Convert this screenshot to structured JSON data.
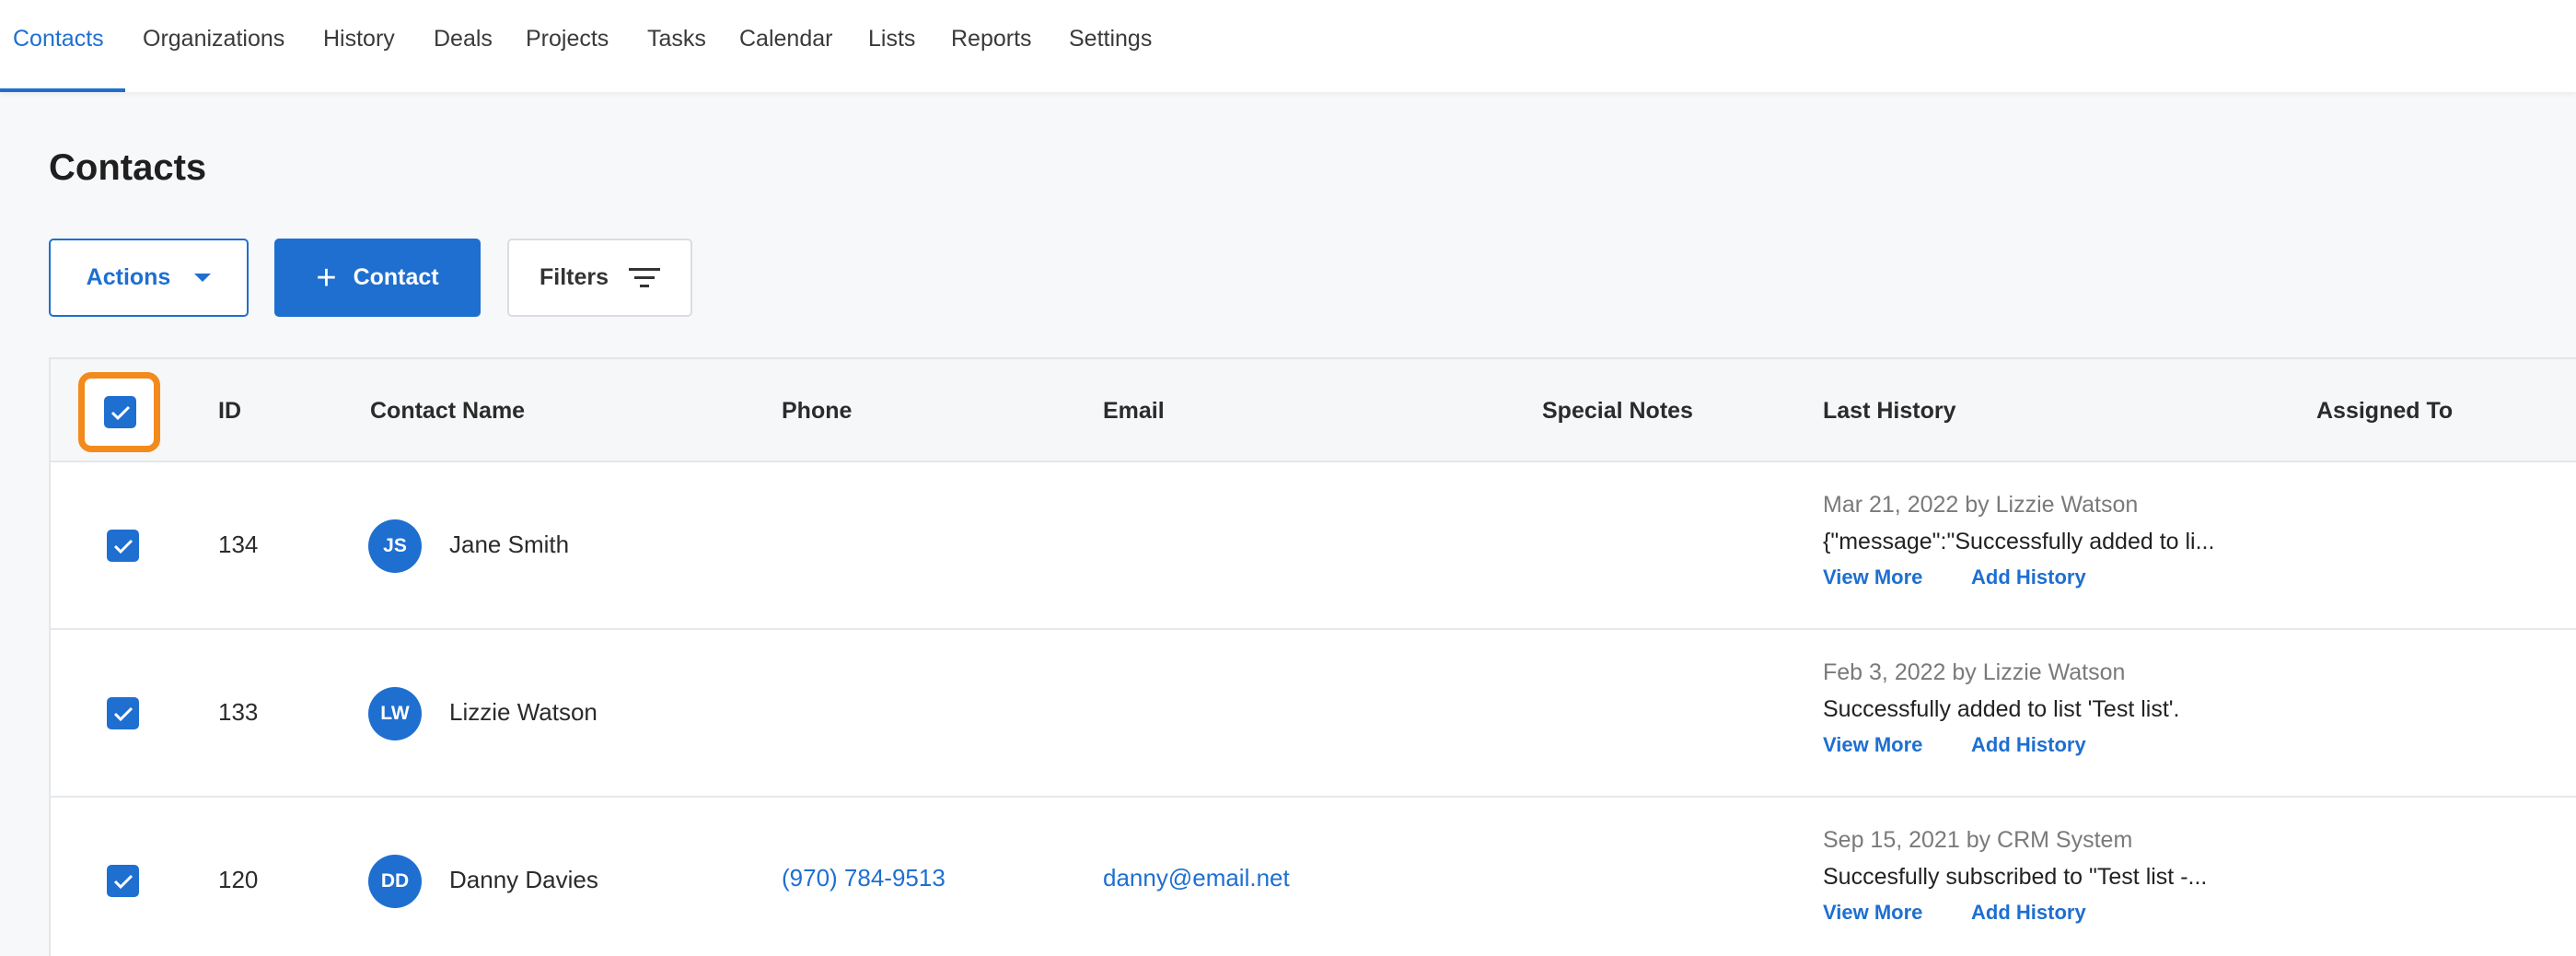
{
  "nav": {
    "tabs": [
      "Contacts",
      "Organizations",
      "History",
      "Deals",
      "Projects",
      "Tasks",
      "Calendar",
      "Lists",
      "Reports",
      "Settings"
    ],
    "active": "Contacts"
  },
  "page": {
    "title": "Contacts"
  },
  "toolbar": {
    "actions_label": "Actions",
    "add_contact_label": "Contact",
    "filters_label": "Filters"
  },
  "table": {
    "headers": {
      "id": "ID",
      "name": "Contact Name",
      "phone": "Phone",
      "email": "Email",
      "notes": "Special Notes",
      "last_history": "Last History",
      "assigned": "Assigned To"
    },
    "select_all_checked": true,
    "rows": [
      {
        "checked": true,
        "id": "134",
        "initials": "JS",
        "name": "Jane Smith",
        "phone": "",
        "email": "",
        "notes": "",
        "history_meta": "Mar 21, 2022 by Lizzie Watson",
        "history_msg": "{\"message\":\"Successfully added to li...",
        "view_more": "View More",
        "add_history": "Add History",
        "assigned": ""
      },
      {
        "checked": true,
        "id": "133",
        "initials": "LW",
        "name": "Lizzie Watson",
        "phone": "",
        "email": "",
        "notes": "",
        "history_meta": "Feb 3, 2022 by Lizzie Watson",
        "history_msg": "Successfully added to list 'Test list'.",
        "view_more": "View More",
        "add_history": "Add History",
        "assigned": ""
      },
      {
        "checked": true,
        "id": "120",
        "initials": "DD",
        "name": "Danny Davies",
        "phone": "(970) 784-9513",
        "email": "danny@email.net",
        "notes": "",
        "history_meta": "Sep 15, 2021 by CRM System",
        "history_msg": "Succesfully subscribed to \"Test list -...",
        "view_more": "View More",
        "add_history": "Add History",
        "assigned": ""
      }
    ]
  },
  "colors": {
    "accent": "#1e6fd0",
    "highlight": "#f28b1c",
    "page_bg": "#f7f8fa"
  }
}
